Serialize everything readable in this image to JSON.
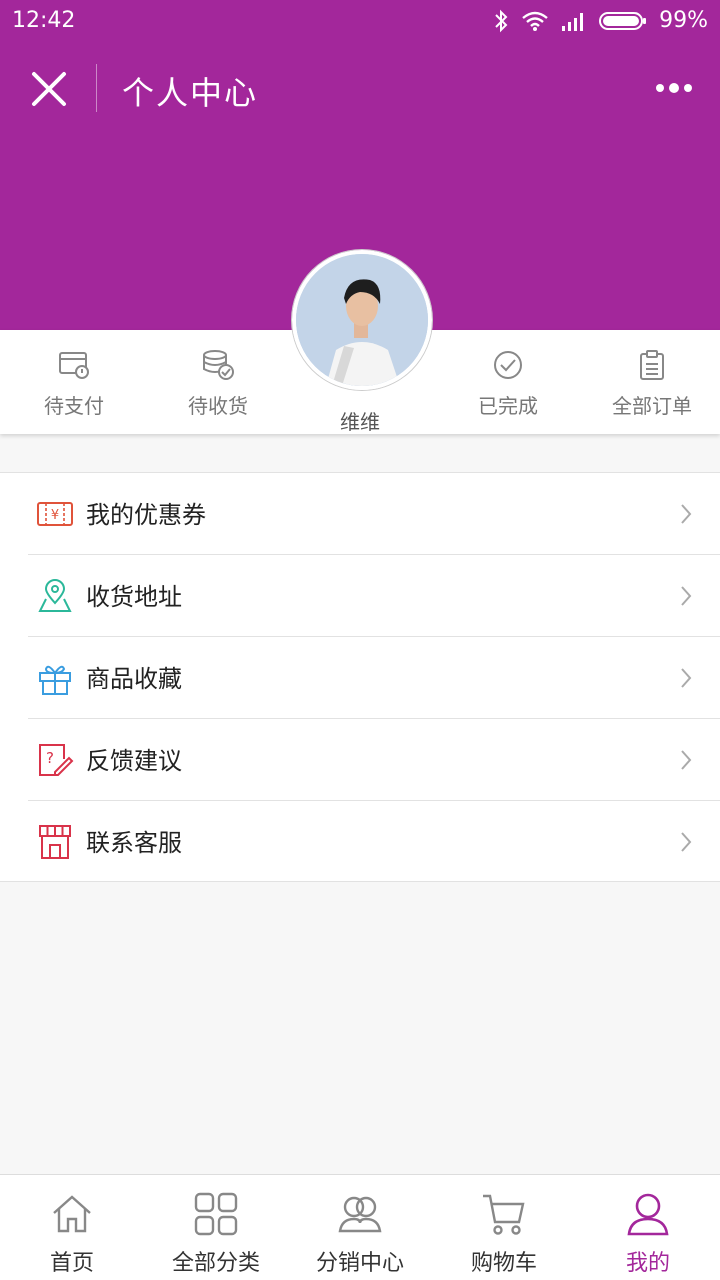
{
  "status_bar": {
    "time": "12:42",
    "battery": "99%"
  },
  "header": {
    "title": "个人中心"
  },
  "colors": {
    "brand": "#a3279b",
    "header_bg": "#a3279b"
  },
  "user": {
    "name": "维维"
  },
  "orders": [
    {
      "label": "待支付",
      "icon": "payment-card-icon"
    },
    {
      "label": "待收货",
      "icon": "coins-check-icon"
    },
    {
      "label": "已完成",
      "icon": "check-circle-icon"
    },
    {
      "label": "全部订单",
      "icon": "clipboard-icon"
    }
  ],
  "menu": [
    {
      "label": "我的优惠券",
      "icon": "coupon-icon"
    },
    {
      "label": "收货地址",
      "icon": "map-pin-icon"
    },
    {
      "label": "商品收藏",
      "icon": "gift-icon"
    },
    {
      "label": "反馈建议",
      "icon": "feedback-icon"
    },
    {
      "label": "联系客服",
      "icon": "store-icon"
    }
  ],
  "tabs": [
    {
      "label": "首页",
      "icon": "home-icon"
    },
    {
      "label": "全部分类",
      "icon": "grid-icon"
    },
    {
      "label": "分销中心",
      "icon": "users-icon"
    },
    {
      "label": "购物车",
      "icon": "cart-icon"
    },
    {
      "label": "我的",
      "icon": "profile-icon",
      "active": true
    }
  ]
}
